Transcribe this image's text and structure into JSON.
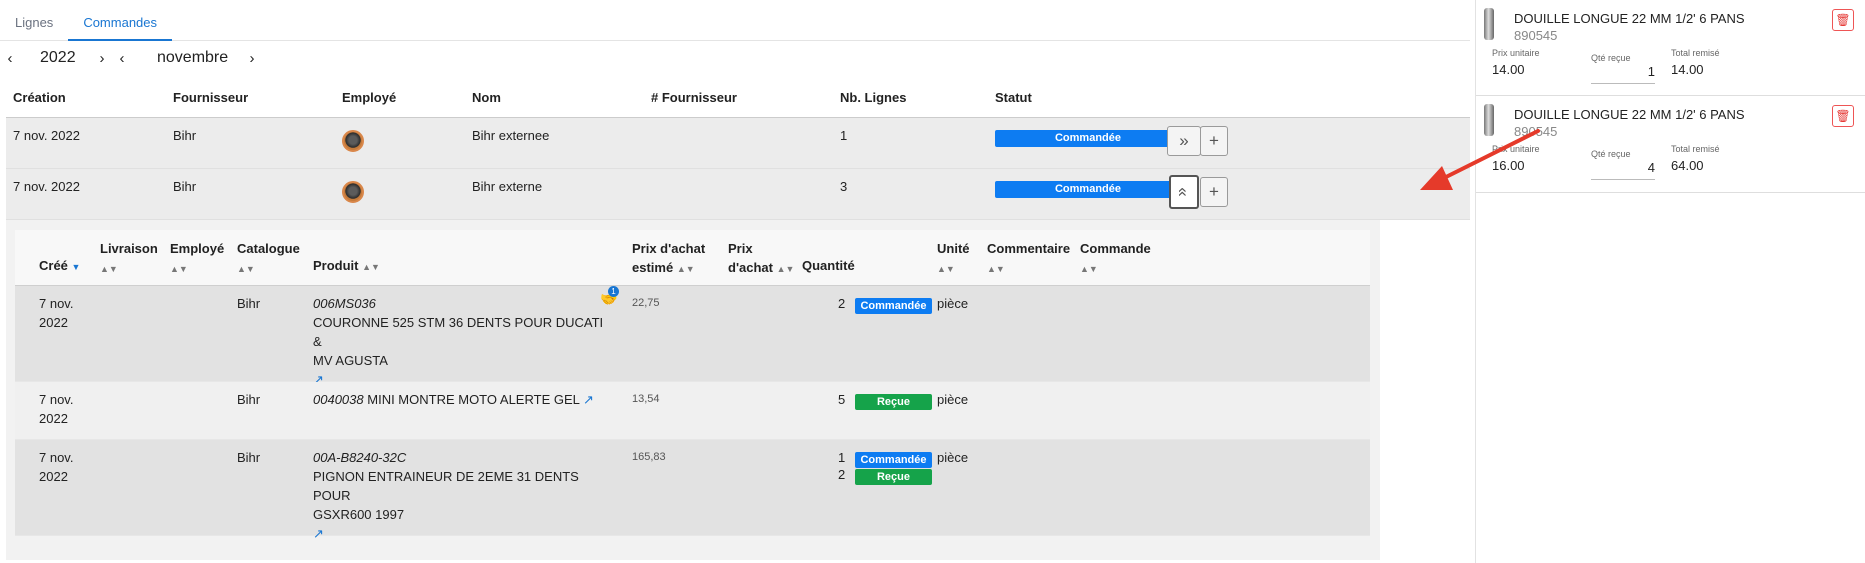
{
  "tabs": [
    {
      "label": "Lignes"
    },
    {
      "label": "Commandes"
    }
  ],
  "datenav": {
    "prev": "‹",
    "year": "2022",
    "next": "›",
    "month": "novembre"
  },
  "orders": {
    "headers": [
      "Création",
      "Fournisseur",
      "Employé",
      "Nom",
      "# Fournisseur",
      "Nb. Lignes",
      "Statut"
    ],
    "rows": [
      {
        "created": "7 nov. 2022",
        "supplier": "Bihr",
        "name": "Bihr externee",
        "supplier_no": "",
        "lines": "1",
        "status": "Commandée"
      },
      {
        "created": "7 nov. 2022",
        "supplier": "Bihr",
        "name": "Bihr externe",
        "supplier_no": "",
        "lines": "3",
        "status": "Commandée"
      }
    ],
    "btn_expand": "»",
    "btn_collapse": "«",
    "btn_add": "+"
  },
  "lines": {
    "headers": {
      "created": "Créé",
      "delivery": "Livraison",
      "employee": "Employé",
      "catalog": "Catalogue",
      "product": "Produit",
      "est_price_1": "Prix d'achat",
      "est_price_2": "estimé",
      "price_1": "Prix",
      "price_2": "d'achat",
      "quantity": "Quantité",
      "unit": "Unité",
      "comment": "Commentaire",
      "order": "Commande"
    },
    "rows": [
      {
        "created_1": "7 nov.",
        "created_2": "2022",
        "catalog": "Bihr",
        "ref": "006MS036",
        "desc_1": "COURONNE 525 STM 36 DENTS POUR DUCATI &",
        "desc_2": "MV AGUSTA",
        "est_price": "22,75",
        "qty_1": "2",
        "status_1": "Commandée",
        "unit": "pièce",
        "badge_count": "1"
      },
      {
        "created_1": "7 nov.",
        "created_2": "2022",
        "catalog": "Bihr",
        "ref": "0040038",
        "desc_1": "MINI MONTRE MOTO ALERTE GEL",
        "est_price": "13,54",
        "qty_1": "5",
        "status_1": "Reçue",
        "unit": "pièce"
      },
      {
        "created_1": "7 nov.",
        "created_2": "2022",
        "catalog": "Bihr",
        "ref": "00A-B8240-32C",
        "desc_1": "PIGNON ENTRAINEUR DE 2EME 31 DENTS POUR",
        "desc_2": "GSXR600 1997",
        "est_price": "165,83",
        "qty_1": "1",
        "status_1": "Commandée",
        "qty_2": "2",
        "status_2": "Reçue",
        "unit": "pièce"
      }
    ]
  },
  "cart": [
    {
      "name": "DOUILLE LONGUE 22 MM 1/2' 6 PANS",
      "code": "890545",
      "unit_price_label": "Prix unitaire",
      "unit_price": "14.00",
      "qty_label": "Qté reçue",
      "qty": "1",
      "total_label": "Total remisé",
      "total": "14.00"
    },
    {
      "name": "DOUILLE LONGUE 22 MM 1/2' 6 PANS",
      "code": "890545",
      "unit_price_label": "Prix unitaire",
      "unit_price": "16.00",
      "qty_label": "Qté reçue",
      "qty": "4",
      "total_label": "Total remisé",
      "total": "64.00"
    }
  ],
  "colors": {
    "accent": "#1976d2",
    "status_ordered": "#0d7cf2",
    "status_received": "#15a34a",
    "delete": "#e53935",
    "annotation_arrow": "#e53a2a"
  }
}
